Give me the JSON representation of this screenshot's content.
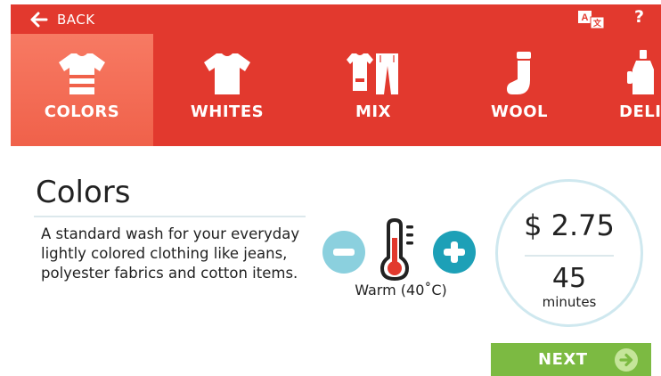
{
  "topbar": {
    "back_label": "BACK",
    "help_label": "?",
    "icons": {
      "back": "arrow-left-icon",
      "translate": "translate-icon"
    }
  },
  "tabs": [
    {
      "label": "COLORS",
      "icon": "colored-tshirt-icon",
      "active": true
    },
    {
      "label": "WHITES",
      "icon": "tshirt-icon",
      "active": false
    },
    {
      "label": "MIX",
      "icon": "shirt-and-pants-icon",
      "active": false
    },
    {
      "label": "WOOL",
      "icon": "sock-icon",
      "active": false
    },
    {
      "label": "DELIC",
      "icon": "bottle-icon",
      "active": false
    }
  ],
  "program": {
    "title": "Colors",
    "description": "A standard wash for your everyday lightly colored clothing like jeans, polyester fabrics and cotton items."
  },
  "temperature": {
    "label": "Warm (40˚C)",
    "icons": {
      "decrease": "minus-icon",
      "thermometer": "thermometer-icon",
      "increase": "plus-icon"
    }
  },
  "summary": {
    "price": "$ 2.75",
    "minutes_value": "45",
    "minutes_label": "minutes"
  },
  "next": {
    "label": "NEXT",
    "icon": "arrow-right-circle-icon"
  },
  "colors": {
    "primary_red": "#e2392e",
    "active_tab": "#f0614a",
    "teal": "#1da0b7",
    "light_teal": "#8bd0de",
    "green": "#7cba42"
  }
}
